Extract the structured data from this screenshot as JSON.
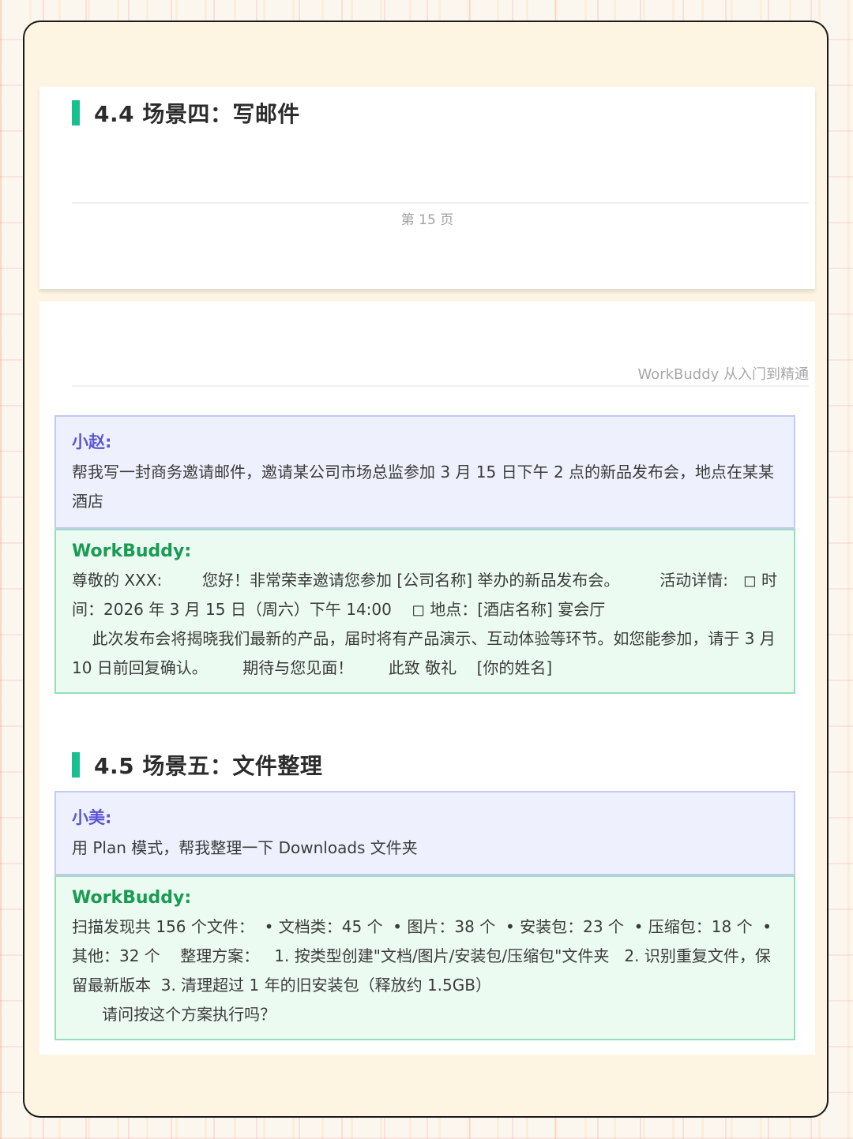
{
  "page_top": {
    "heading": "4.4 场景四：写邮件",
    "page_number": "第 15 页"
  },
  "page_next": {
    "running_header": "WorkBuddy 从入门到精通"
  },
  "scene4": {
    "user_name": "小赵:",
    "user_message": "帮我写一封商务邀请邮件，邀请某公司市场总监参加 3 月 15 日下午 2 点的新品发布会，地点在某某酒店",
    "bot_name": "WorkBuddy:",
    "bot_message": "尊敬的 XXX:        您好！非常荣幸邀请您参加 [公司名称] 举办的新品发布会。        活动详情:   ◻ 时间：2026 年 3 月 15 日（周六）下午 14:00    ◻ 地点：[酒店名称] 宴会厅\n    此次发布会将揭晓我们最新的产品，届时将有产品演示、互动体验等环节。如您能参加，请于 3 月 10 日前回复确认。       期待与您见面！       此致 敬礼    [你的姓名]"
  },
  "scene5": {
    "heading": "4.5 场景五：文件整理",
    "user_name": "小美:",
    "user_message": "用 Plan 模式，帮我整理一下 Downloads 文件夹",
    "bot_name": "WorkBuddy:",
    "bot_message": "扫描发现共 156 个文件：  • 文档类：45 个  • 图片：38 个  • 安装包：23 个  • 压缩包：18 个  • 其他：32 个    整理方案：   1. 按类型创建\"文档/图片/安装包/压缩包\"文件夹   2. 识别重复文件，保留最新版本  3. 清理超过 1 年的旧安装包（释放约 1.5GB）\n      请问按这个方案执行吗？"
  },
  "colors": {
    "accent_bar": "#19c08f",
    "user_name": "#5b55d6",
    "bot_name": "#179c52"
  }
}
